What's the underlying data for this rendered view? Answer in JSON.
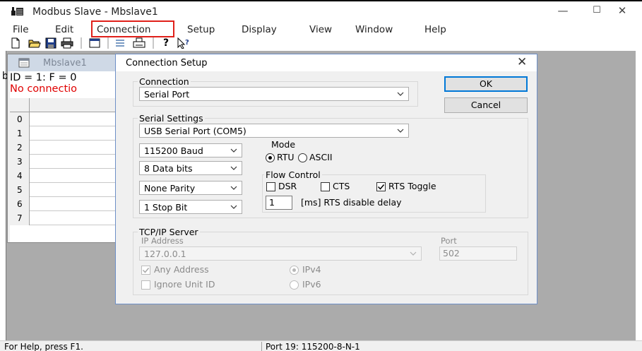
{
  "app": {
    "title": "Modbus Slave - Mbslave1",
    "minimize": "—",
    "maximize": "☐",
    "close": "✕"
  },
  "menu": [
    {
      "label": "File"
    },
    {
      "label": "Edit"
    },
    {
      "label": "Connection"
    },
    {
      "label": "Setup"
    },
    {
      "label": "Display"
    },
    {
      "label": "View"
    },
    {
      "label": "Window"
    },
    {
      "label": "Help"
    }
  ],
  "child": {
    "title": "Mbslave1",
    "status_line1": "ID = 1: F = 0",
    "status_line2": "No connectio",
    "rows": [
      "0",
      "1",
      "2",
      "3",
      "4",
      "5",
      "6",
      "7"
    ]
  },
  "left_fragment": "b",
  "dialog": {
    "title": "Connection Setup",
    "connection": {
      "label": "Connection",
      "value": "Serial Port"
    },
    "ok_label": "OK",
    "cancel_label": "Cancel",
    "serial": {
      "label": "Serial Settings",
      "port": "USB Serial Port (COM5)",
      "baud": "115200 Baud",
      "data_bits": "8 Data bits",
      "parity": "None Parity",
      "stop_bits": "1 Stop Bit"
    },
    "mode": {
      "label": "Mode",
      "rtu": "RTU",
      "ascii": "ASCII",
      "selected": "RTU"
    },
    "flow": {
      "label": "Flow Control",
      "dsr": "DSR",
      "cts": "CTS",
      "rts_toggle": "RTS Toggle",
      "dsr_checked": false,
      "cts_checked": false,
      "rts_checked": true,
      "delay_value": "1",
      "delay_label": "[ms] RTS disable delay"
    },
    "tcp": {
      "label": "TCP/IP Server",
      "ip_label": "IP Address",
      "ip_value": "127.0.0.1",
      "port_label": "Port",
      "port_value": "502",
      "any_address": "Any Address",
      "any_address_checked": true,
      "ignore_unit": "Ignore Unit ID",
      "ignore_unit_checked": false,
      "ipv4": "IPv4",
      "ipv6": "IPv6"
    }
  },
  "status": {
    "left": "For Help, press F1.",
    "right": "Port 19: 115200-8-N-1"
  }
}
